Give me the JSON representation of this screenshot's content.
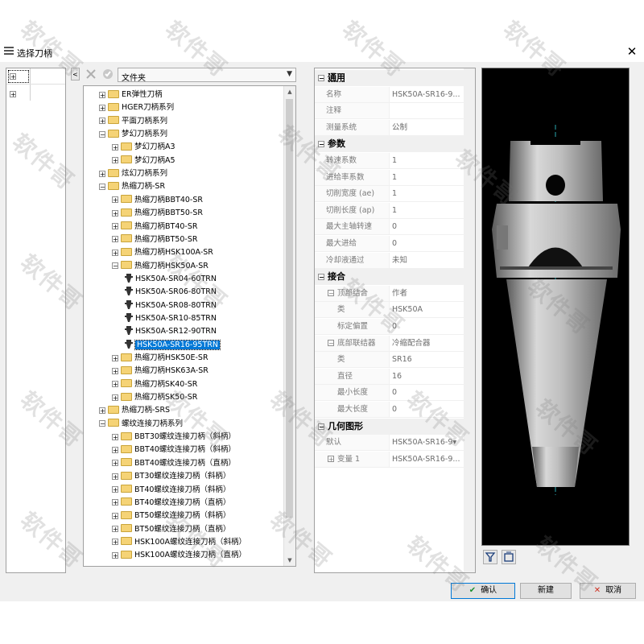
{
  "window": {
    "title": "选择刀柄",
    "close_glyph": "✕"
  },
  "toolbar": {
    "filter_value": "文件夹"
  },
  "tree": {
    "items": [
      {
        "label": "ER弹性刀柄",
        "kind": "folder",
        "level": 1,
        "expander": "+"
      },
      {
        "label": "HGER刀柄系列",
        "kind": "folder",
        "level": 1,
        "expander": "+"
      },
      {
        "label": "平面刀柄系列",
        "kind": "folder",
        "level": 1,
        "expander": "+"
      },
      {
        "label": "梦幻刀柄系列",
        "kind": "folder",
        "level": 1,
        "expander": "−"
      },
      {
        "label": "梦幻刀柄A3",
        "kind": "folder",
        "level": 2,
        "expander": "+"
      },
      {
        "label": "梦幻刀柄A5",
        "kind": "folder",
        "level": 2,
        "expander": "+"
      },
      {
        "label": "炫幻刀柄系列",
        "kind": "folder",
        "level": 1,
        "expander": "+"
      },
      {
        "label": "热缩刀柄-SR",
        "kind": "folder",
        "level": 1,
        "expander": "−"
      },
      {
        "label": "热缩刀柄BBT40-SR",
        "kind": "folder",
        "level": 2,
        "expander": "+"
      },
      {
        "label": "热缩刀柄BBT50-SR",
        "kind": "folder",
        "level": 2,
        "expander": "+"
      },
      {
        "label": "热缩刀柄BT40-SR",
        "kind": "folder",
        "level": 2,
        "expander": "+"
      },
      {
        "label": "热缩刀柄BT50-SR",
        "kind": "folder",
        "level": 2,
        "expander": "+"
      },
      {
        "label": "热缩刀柄HSK100A-SR",
        "kind": "folder",
        "level": 2,
        "expander": "+"
      },
      {
        "label": "热缩刀柄HSK50A-SR",
        "kind": "folder",
        "level": 2,
        "expander": "−"
      },
      {
        "label": "HSK50A-SR04-60TRN",
        "kind": "tool",
        "level": 3,
        "expander": ""
      },
      {
        "label": "HSK50A-SR06-80TRN",
        "kind": "tool",
        "level": 3,
        "expander": ""
      },
      {
        "label": "HSK50A-SR08-80TRN",
        "kind": "tool",
        "level": 3,
        "expander": ""
      },
      {
        "label": "HSK50A-SR10-85TRN",
        "kind": "tool",
        "level": 3,
        "expander": ""
      },
      {
        "label": "HSK50A-SR12-90TRN",
        "kind": "tool",
        "level": 3,
        "expander": ""
      },
      {
        "label": "HSK50A-SR16-95TRN",
        "kind": "tool",
        "level": 3,
        "expander": "",
        "selected": true
      },
      {
        "label": "热缩刀柄HSK50E-SR",
        "kind": "folder",
        "level": 2,
        "expander": "+"
      },
      {
        "label": "热缩刀柄HSK63A-SR",
        "kind": "folder",
        "level": 2,
        "expander": "+"
      },
      {
        "label": "热缩刀柄SK40-SR",
        "kind": "folder",
        "level": 2,
        "expander": "+"
      },
      {
        "label": "热缩刀柄SK50-SR",
        "kind": "folder",
        "level": 2,
        "expander": "+"
      },
      {
        "label": "热缩刀柄-SRS",
        "kind": "folder",
        "level": 1,
        "expander": "+"
      },
      {
        "label": "螺纹连接刀柄系列",
        "kind": "folder",
        "level": 1,
        "expander": "−"
      },
      {
        "label": "BBT30螺纹连接刀柄（斜柄）",
        "kind": "folder",
        "level": 2,
        "expander": "+"
      },
      {
        "label": "BBT40螺纹连接刀柄（斜柄）",
        "kind": "folder",
        "level": 2,
        "expander": "+"
      },
      {
        "label": "BBT40螺纹连接刀柄（直柄）",
        "kind": "folder",
        "level": 2,
        "expander": "+"
      },
      {
        "label": "BT30螺纹连接刀柄（斜柄）",
        "kind": "folder",
        "level": 2,
        "expander": "+"
      },
      {
        "label": "BT40螺纹连接刀柄（斜柄）",
        "kind": "folder",
        "level": 2,
        "expander": "+"
      },
      {
        "label": "BT40螺纹连接刀柄（直柄）",
        "kind": "folder",
        "level": 2,
        "expander": "+"
      },
      {
        "label": "BT50螺纹连接刀柄（斜柄）",
        "kind": "folder",
        "level": 2,
        "expander": "+"
      },
      {
        "label": "BT50螺纹连接刀柄（直柄）",
        "kind": "folder",
        "level": 2,
        "expander": "+"
      },
      {
        "label": "HSK100A螺纹连接刀柄（斜柄）",
        "kind": "folder",
        "level": 2,
        "expander": "+"
      },
      {
        "label": "HSK100A螺纹连接刀柄（直柄）",
        "kind": "folder",
        "level": 2,
        "expander": "+"
      }
    ]
  },
  "properties": {
    "rows": [
      {
        "type": "cat",
        "label": "通用",
        "focus": true
      },
      {
        "type": "row",
        "name": "名称",
        "value": "HSK50A-SR16-9..."
      },
      {
        "type": "row",
        "name": "注释",
        "value": ""
      },
      {
        "type": "row",
        "name": "测量系统",
        "value": "公制"
      },
      {
        "type": "cat",
        "label": "参数"
      },
      {
        "type": "row",
        "name": "转速系数",
        "value": "1"
      },
      {
        "type": "row",
        "name": "进给率系数",
        "value": "1"
      },
      {
        "type": "row",
        "name": "切削宽度 (ae)",
        "value": "1"
      },
      {
        "type": "row",
        "name": "切削长度 (ap)",
        "value": "1"
      },
      {
        "type": "row",
        "name": "最大主轴转速",
        "value": "0"
      },
      {
        "type": "row",
        "name": "最大进给",
        "value": "0"
      },
      {
        "type": "row",
        "name": "冷却液通过",
        "value": "未知"
      },
      {
        "type": "cat",
        "label": "接合"
      },
      {
        "type": "row",
        "name": "顶部结合",
        "value": "作者",
        "expander": "−"
      },
      {
        "type": "row",
        "name": "类",
        "value": "HSK50A",
        "indent": 2
      },
      {
        "type": "row",
        "name": "标定偏置",
        "value": "0",
        "indent": 2
      },
      {
        "type": "row",
        "name": "底部联结器",
        "value": "冷缩配合器",
        "expander": "−"
      },
      {
        "type": "row",
        "name": "类",
        "value": "SR16",
        "indent": 2
      },
      {
        "type": "row",
        "name": "直径",
        "value": "16",
        "indent": 2
      },
      {
        "type": "row",
        "name": "最小长度",
        "value": "0",
        "indent": 2
      },
      {
        "type": "row",
        "name": "最大长度",
        "value": "0",
        "indent": 2
      },
      {
        "type": "cat",
        "label": "几何图形"
      },
      {
        "type": "row",
        "name": "默认",
        "value": "HSK50A-SR16-9▾"
      },
      {
        "type": "row",
        "name": "变量 1",
        "value": "HSK50A-SR16-9...",
        "expander": "+"
      }
    ]
  },
  "mini_tree": {
    "rows": [
      "+",
      "+"
    ]
  },
  "buttons": {
    "ok": "确认",
    "new": "新建",
    "cancel": "取消"
  },
  "watermark": "软件哥",
  "colors": {
    "selection": "#0078d7",
    "preview_bg": "#000000",
    "folder": "#f5d376"
  }
}
